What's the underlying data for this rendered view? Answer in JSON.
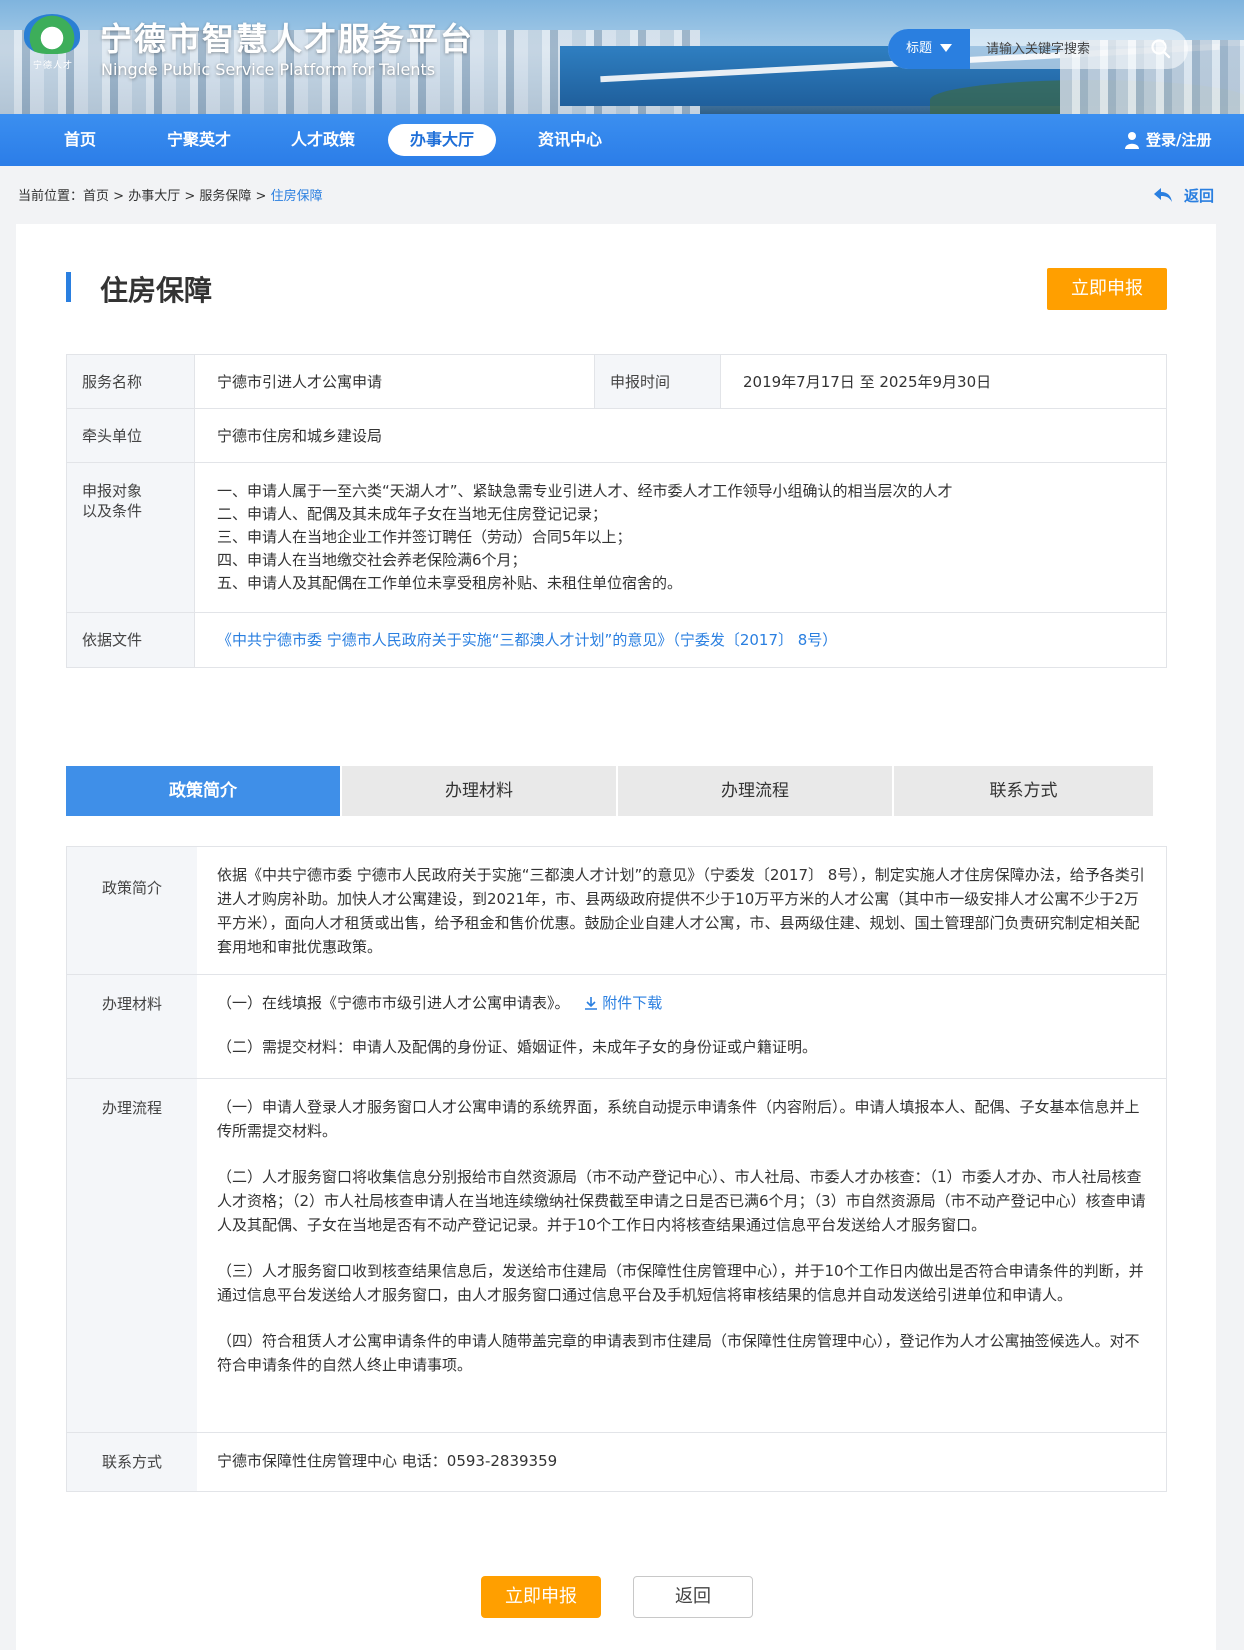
{
  "header": {
    "logo_text": "宁德人才",
    "title": "宁德市智慧人才服务平台",
    "subtitle": "Ningde Public Service Platform for Talents",
    "search": {
      "category": "标题",
      "placeholder": "请输入关键字搜索"
    }
  },
  "nav": {
    "items": [
      {
        "label": "首页"
      },
      {
        "label": "宁聚英才"
      },
      {
        "label": "人才政策"
      },
      {
        "label": "办事大厅"
      },
      {
        "label": "资讯中心"
      }
    ],
    "active": "办事大厅",
    "login": "登录/注册"
  },
  "breadcrumb": {
    "prefix": "当前位置：",
    "items": [
      "首页",
      "办事大厅",
      "服务保障",
      "住房保障"
    ],
    "separator": " > ",
    "back": "返回"
  },
  "page": {
    "title": "住房保障",
    "apply_button": "立即申报"
  },
  "info": {
    "service_name_label": "服务名称",
    "service_name": "宁德市引进人才公寓申请",
    "time_label": "申报时间",
    "time_value": "2019年7月17日  至  2025年9月30日",
    "unit_label": "牵头单位",
    "unit": "宁德市住房和城乡建设局",
    "conditions_label_1": "申报对象",
    "conditions_label_2": "以及条件",
    "conditions": [
      "一、申请人属于一至六类“天湖人才”、紧缺急需专业引进人才、经市委人才工作领导小组确认的相当层次的人才",
      "二、申请人、配偶及其未成年子女在当地无住房登记记录；",
      "三、申请人在当地企业工作并签订聘任（劳动）合同5年以上；",
      "四、申请人在当地缴交社会养老保险满6个月；",
      "五、申请人及其配偶在工作单位未享受租房补贴、未租住单位宿舍的。"
    ],
    "basis_label": "依据文件",
    "basis": "《中共宁德市委 宁德市人民政府关于实施“三都澳人才计划”的意见》（宁委发〔2017〕 8号）"
  },
  "tabs": [
    "政策简介",
    "办理材料",
    "办理流程",
    "联系方式"
  ],
  "active_tab": "政策简介",
  "detail": {
    "intro_label": "政策简介",
    "intro": "依据《中共宁德市委 宁德市人民政府关于实施“三都澳人才计划”的意见》（宁委发〔2017〕 8号），制定实施人才住房保障办法，给予各类引进人才购房补助。加快人才公寓建设，到2021年，市、县两级政府提供不少于10万平方米的人才公寓（其中市一级安排人才公寓不少于2万平方米），面向人才租赁或出售，给予租金和售价优惠。鼓励企业自建人才公寓，市、县两级住建、规划、国土管理部门负责研究制定相关配套用地和审批优惠政策。",
    "materials_label": "办理材料",
    "materials_1": "（一）在线填报《宁德市市级引进人才公寓申请表》。",
    "materials_download": "附件下载",
    "materials_2": "（二）需提交材料：申请人及配偶的身份证、婚姻证件，未成年子女的身份证或户籍证明。",
    "process_label": "办理流程",
    "process": [
      "（一）申请人登录人才服务窗口人才公寓申请的系统界面，系统自动提示申请条件（内容附后）。申请人填报本人、配偶、子女基本信息并上传所需提交材料。",
      "（二）人才服务窗口将收集信息分别报给市自然资源局（市不动产登记中心）、市人社局、市委人才办核查：（1）市委人才办、市人社局核查人才资格；（2）市人社局核查申请人在当地连续缴纳社保费截至申请之日是否已满6个月；（3）市自然资源局（市不动产登记中心）核查申请人及其配偶、子女在当地是否有不动产登记记录。并于10个工作日内将核查结果通过信息平台发送给人才服务窗口。",
      "（三）人才服务窗口收到核查结果信息后，发送给市住建局（市保障性住房管理中心），并于10个工作日内做出是否符合申请条件的判断，并通过信息平台发送给人才服务窗口，由人才服务窗口通过信息平台及手机短信将审核结果的信息并自动发送给引进单位和申请人。",
      "（四）符合租赁人才公寓申请条件的申请人随带盖完章的申请表到市住建局（市保障性住房管理中心），登记作为人才公寓抽签候选人。对不符合申请条件的自然人终止申请事项。"
    ],
    "contact_label": "联系方式",
    "contact": "宁德市保障性住房管理中心 电话：0593-2839359"
  },
  "footer": {
    "apply": "立即申报",
    "back": "返回"
  }
}
